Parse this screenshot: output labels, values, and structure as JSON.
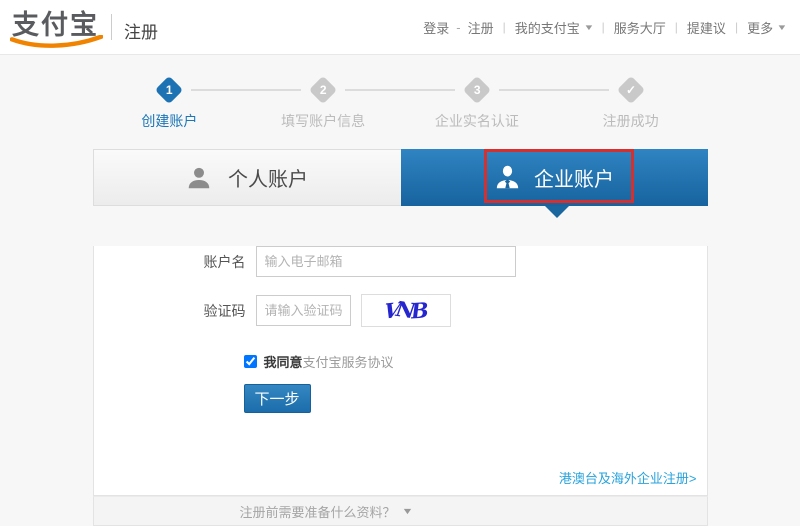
{
  "header": {
    "logo_text": "支付宝",
    "page_label": "注册",
    "nav": {
      "login": "登录",
      "register": "注册",
      "my_alipay": "我的支付宝",
      "service_hall": "服务大厅",
      "suggest": "提建议",
      "more": "更多",
      "dash": "-",
      "pipe": "|"
    }
  },
  "icons": {
    "caret_down": "▼"
  },
  "steps": {
    "items": [
      {
        "num": "1",
        "label": "创建账户",
        "state": "active"
      },
      {
        "num": "2",
        "label": "填写账户信息",
        "state": "inactive"
      },
      {
        "num": "3",
        "label": "企业实名认证",
        "state": "inactive"
      },
      {
        "num": "✓",
        "label": "注册成功",
        "state": "inactive"
      }
    ]
  },
  "tabs": {
    "personal": "个人账户",
    "enterprise": "企业账户"
  },
  "form": {
    "account_label": "账户名",
    "account_placeholder": "输入电子邮箱",
    "captcha_label": "验证码",
    "captcha_placeholder": "请输入验证码",
    "captcha_letters": [
      "V",
      "N",
      "B"
    ],
    "agreement_prefix": "我同意",
    "agreement_link": "支付宝服务协议",
    "agreement_checked": true,
    "next_button": "下一步",
    "overseas_link": "港澳台及海外企业注册>",
    "footer_question": "注册前需要准备什么资料？"
  },
  "colors": {
    "brand_orange": "#f08300",
    "active_blue": "#1d72b4",
    "tab_blue_top": "#2f84c1",
    "tab_blue_bottom": "#17639f",
    "annotation_red": "#d43030",
    "captcha_blue": "#2626cf",
    "overseas_link_blue": "#28a3dc"
  }
}
